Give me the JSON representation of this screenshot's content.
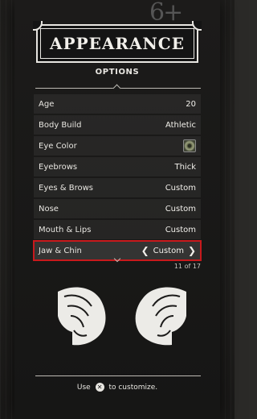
{
  "background": {
    "corner_number": "6+"
  },
  "header": {
    "title": "APPEARANCE",
    "subtitle": "OPTIONS"
  },
  "menu": {
    "items": [
      {
        "label": "Age",
        "value": "20"
      },
      {
        "label": "Body Build",
        "value": "Athletic"
      },
      {
        "label": "Eye Color",
        "value": "",
        "swatch_color": "#6f7553"
      },
      {
        "label": "Eyebrows",
        "value": "Thick"
      },
      {
        "label": "Eyes & Brows",
        "value": "Custom"
      },
      {
        "label": "Nose",
        "value": "Custom"
      },
      {
        "label": "Mouth & Lips",
        "value": "Custom"
      },
      {
        "label": "Jaw & Chin",
        "value": "Custom",
        "selected": true
      }
    ],
    "counter": "11 of 17"
  },
  "footer": {
    "prefix": "Use",
    "button_glyph": "✕",
    "suffix": "to customize."
  },
  "colors": {
    "selection_outline": "#c8191c",
    "background": "#2b2a28",
    "text": "#e8e6e1"
  }
}
